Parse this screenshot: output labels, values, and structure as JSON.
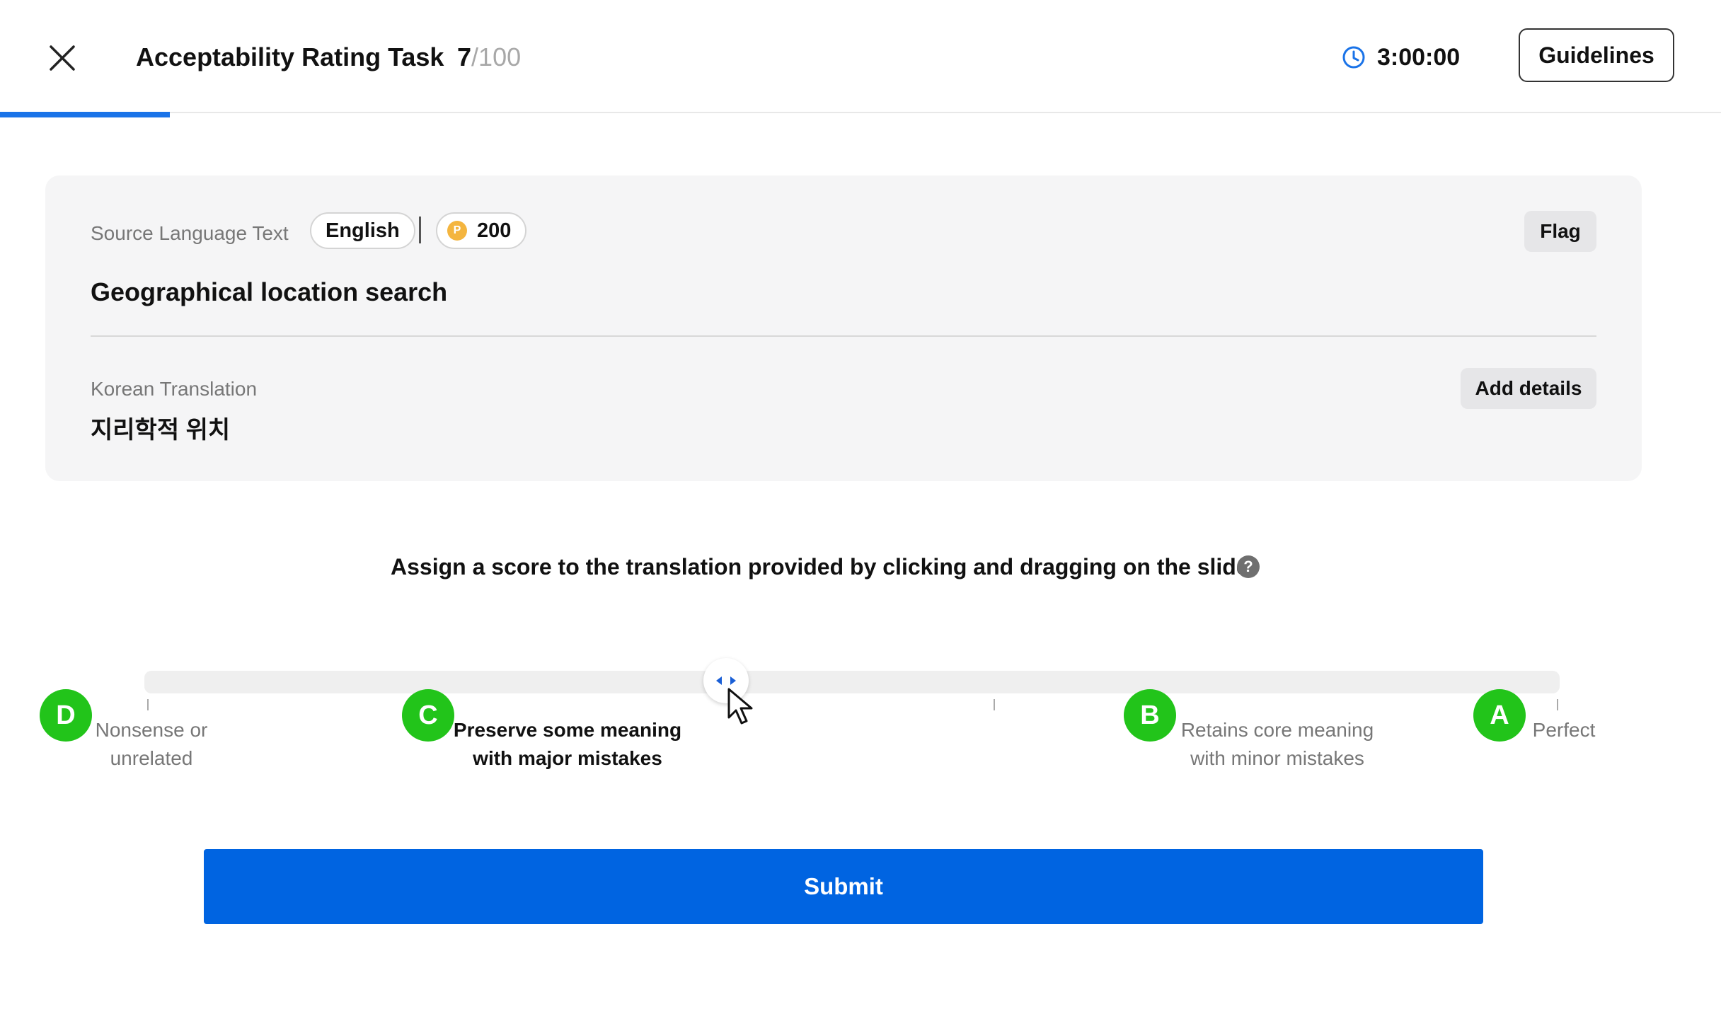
{
  "header": {
    "close_icon": "close-icon",
    "title": "Acceptability Rating Task",
    "progress": {
      "current": "7",
      "separator": "/",
      "total": "100",
      "fraction_complete": 0.07
    },
    "timer": {
      "icon": "clock-icon",
      "value": "3:00:00"
    },
    "guidelines_label": "Guidelines"
  },
  "source": {
    "label": "Source Language Text",
    "language": "English",
    "points": "200",
    "points_icon": "coin-icon",
    "points_icon_letter": "P",
    "flag_label": "Flag",
    "text": "Geographical location search"
  },
  "translation": {
    "label": "Korean Translation",
    "add_details_label": "Add details",
    "text": "지리학적 위치"
  },
  "rating": {
    "instruction": "Assign a score to the translation provided by clicking and dragging on the slider",
    "help_icon": "question-icon",
    "help_glyph": "?",
    "selected_grade": "C",
    "slider_value_fraction": 0.41,
    "grades": [
      {
        "letter": "D",
        "label_line1": "Nonsense or",
        "label_line2": "unrelated"
      },
      {
        "letter": "C",
        "label_line1": "Preserve some meaning",
        "label_line2": "with major mistakes"
      },
      {
        "letter": "B",
        "label_line1": "Retains core meaning",
        "label_line2": "with minor mistakes"
      },
      {
        "letter": "A",
        "label_line1": "Perfect",
        "label_line2": ""
      }
    ],
    "badge_color": "#22c41a"
  },
  "submit_label": "Submit",
  "colors": {
    "accent": "#0064e1",
    "progress": "#1a73e8",
    "coin": "#f4b53f"
  }
}
